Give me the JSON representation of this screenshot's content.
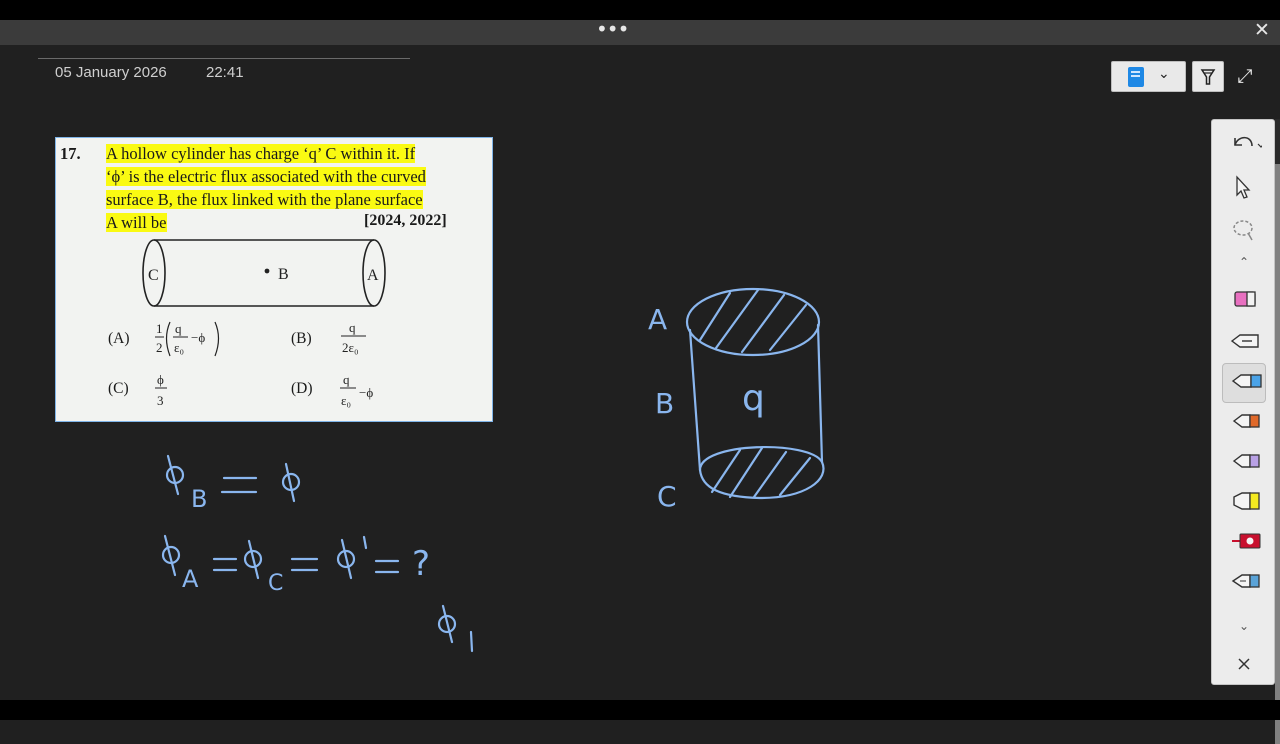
{
  "window": {
    "menu_glyph": "•••",
    "close_glyph": "✕"
  },
  "note": {
    "date": "05 January 2026",
    "time": "22:41"
  },
  "toolbar": {
    "chevron": "⌄",
    "expand_glyph": "⤢"
  },
  "question": {
    "number": "17.",
    "lines": [
      "A hollow cylinder has charge ‘q’ C within it. If",
      "‘ϕ’ is the electric flux associated with the curved",
      "surface B, the flux linked with the plane surface",
      "A will be"
    ],
    "years": "[2024, 2022]",
    "figure_labels": {
      "left": "C",
      "middle": "B",
      "right": "A"
    },
    "options": [
      {
        "label": "(A)",
        "text": "1/2 (q/ε₀ − ϕ)"
      },
      {
        "label": "(B)",
        "text": "q/2ε₀"
      },
      {
        "label": "(C)",
        "text": "ϕ/3"
      },
      {
        "label": "(D)",
        "text": "q/ε₀ − ϕ"
      }
    ]
  },
  "handwriting": {
    "eq1": "ϕB = ϕ",
    "eq2": "ϕA = ϕC = ϕ' = ?",
    "eq3": "ϕ1",
    "cylinder_labels": [
      "A",
      "B",
      "C"
    ],
    "cylinder_charge": "q",
    "ink_color": "#8ab6ee"
  },
  "sidebar": {
    "tools": [
      "undo",
      "select",
      "lasso",
      "eraser",
      "pen",
      "pen",
      "pen",
      "pen",
      "highlighter",
      "ruler",
      "pen"
    ],
    "pen_colors": [
      "#4aa3e8",
      "#e0692a",
      "#b9a1e6",
      "#f4ea20",
      "#c8102e",
      "#5aa3d8"
    ],
    "eraser_color": "#e870c0"
  }
}
